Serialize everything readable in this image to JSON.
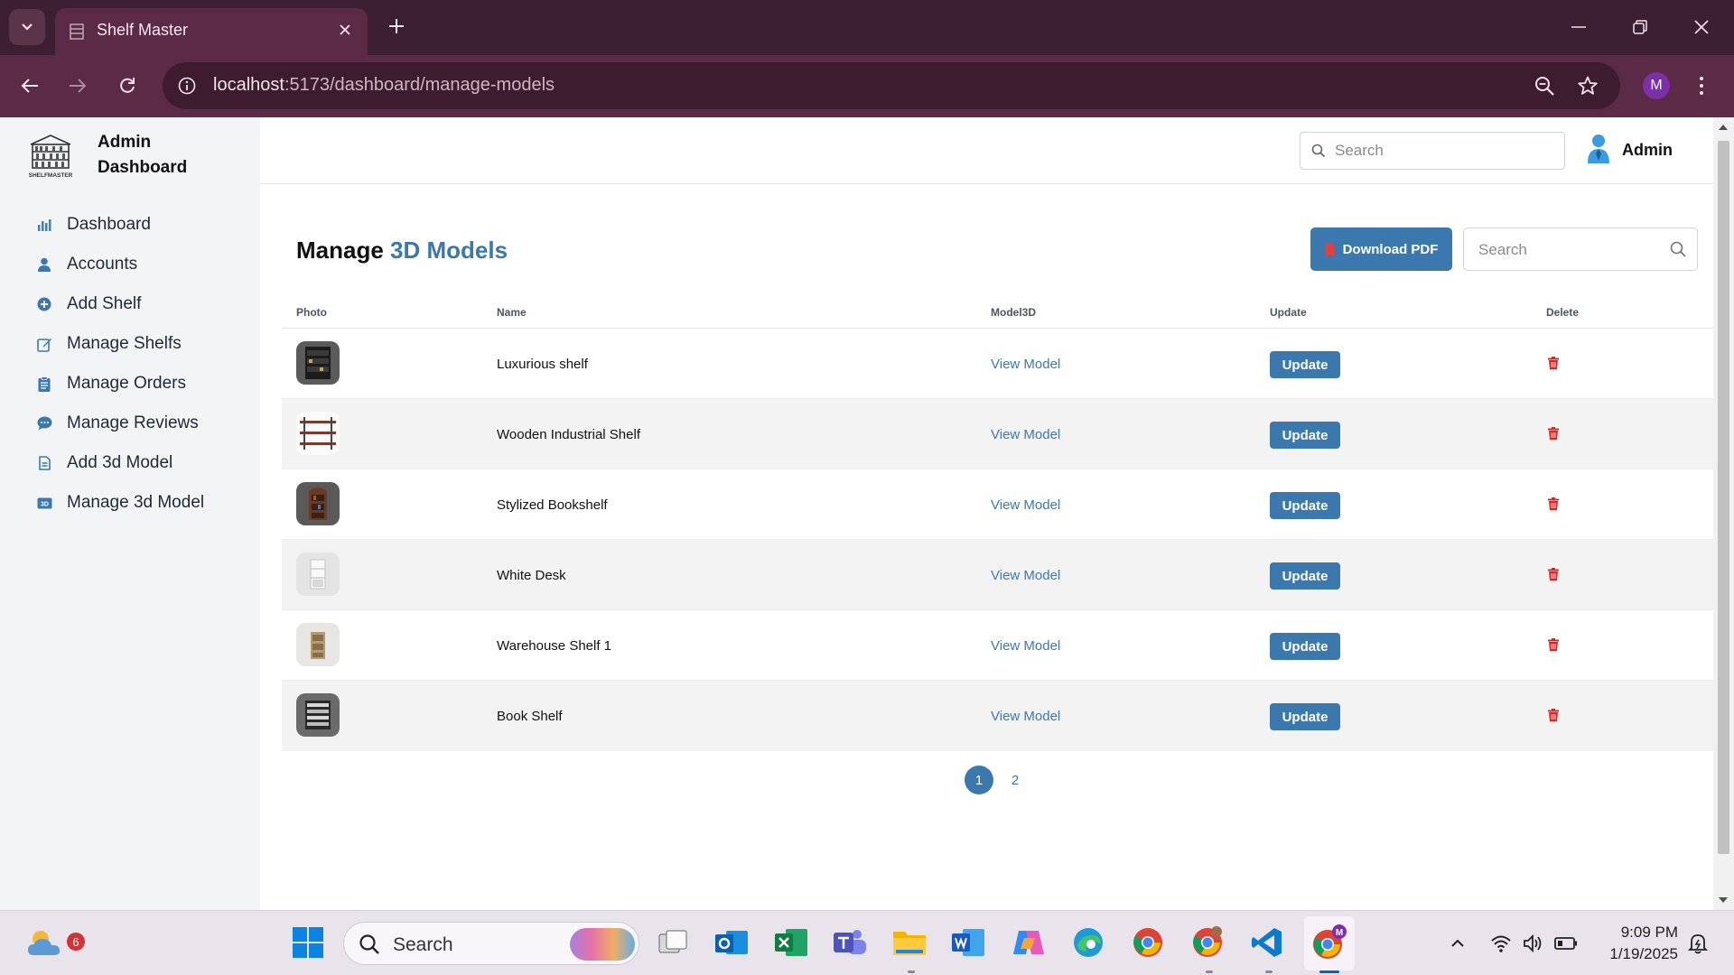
{
  "browser": {
    "tab_title": "Shelf Master",
    "url_host": "localhost",
    "url_rest": ":5173/dashboard/manage-models",
    "profile_initial": "M"
  },
  "sidebar": {
    "brand_logo_text": "SHELFMASTER",
    "brand_title": "Admin Dashboard",
    "items": [
      {
        "label": "Dashboard",
        "icon": "chart-icon"
      },
      {
        "label": "Accounts",
        "icon": "user-icon"
      },
      {
        "label": "Add Shelf",
        "icon": "plus-circle-icon"
      },
      {
        "label": "Manage Shelfs",
        "icon": "edit-icon"
      },
      {
        "label": "Manage Orders",
        "icon": "clipboard-icon"
      },
      {
        "label": "Manage Reviews",
        "icon": "comment-icon"
      },
      {
        "label": "Add 3d Model",
        "icon": "file-icon"
      },
      {
        "label": "Manage 3d Model",
        "icon": "3d-icon"
      }
    ]
  },
  "header": {
    "search_placeholder": "Search",
    "admin_name": "Admin"
  },
  "main": {
    "title_prefix": "Manage",
    "title_accent": "3D Models",
    "download_label": "Download PDF",
    "search_placeholder": "Search",
    "columns": [
      "Photo",
      "Name",
      "Model3D",
      "Update",
      "Delete"
    ],
    "rows": [
      {
        "name": "Luxurious shelf",
        "link": "View Model",
        "action": "Update"
      },
      {
        "name": "Wooden Industrial Shelf",
        "link": "View Model",
        "action": "Update"
      },
      {
        "name": "Stylized Bookshelf",
        "link": "View Model",
        "action": "Update"
      },
      {
        "name": "White Desk",
        "link": "View Model",
        "action": "Update"
      },
      {
        "name": "Warehouse Shelf 1",
        "link": "View Model",
        "action": "Update"
      },
      {
        "name": "Book Shelf",
        "link": "View Model",
        "action": "Update"
      }
    ],
    "pages": [
      "1",
      "2"
    ],
    "current_page": "1"
  },
  "taskbar": {
    "weather_badge": "6",
    "search_label": "Search",
    "time": "9:09 PM",
    "date": "1/19/2025"
  },
  "colors": {
    "accent": "#3b78ad",
    "delete": "#dc2626",
    "chrome_dark": "#3c1f32",
    "chrome_toolbar": "#5a2a46"
  }
}
